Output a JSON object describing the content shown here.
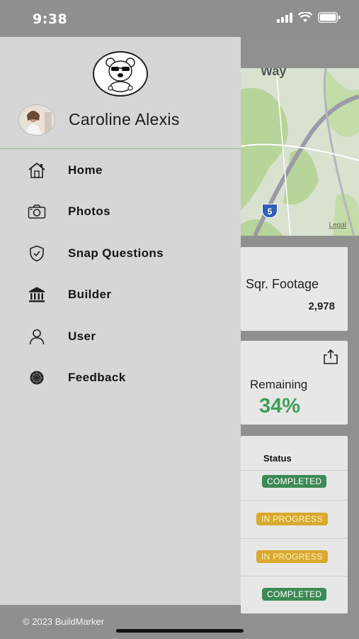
{
  "status_bar": {
    "time": "9:38"
  },
  "drawer": {
    "user_name": "Caroline Alexis",
    "menu": [
      {
        "label": "Home",
        "icon": "home-icon"
      },
      {
        "label": "Photos",
        "icon": "camera-icon"
      },
      {
        "label": "Snap Questions",
        "icon": "shield-icon"
      },
      {
        "label": "Builder",
        "icon": "bank-icon"
      },
      {
        "label": "User",
        "icon": "user-icon"
      },
      {
        "label": "Feedback",
        "icon": "feedback-icon"
      }
    ],
    "footer": "© 2023 BuildMarker"
  },
  "background": {
    "map": {
      "road_label": "Way",
      "route_shield": "5",
      "legal": "Legal"
    },
    "sqft": {
      "label": "Sqr. Footage",
      "value": "2,978"
    },
    "remaining": {
      "label": "Remaining",
      "value": "34%"
    },
    "table": {
      "header": "Status",
      "rows": [
        {
          "status": "COMPLETED"
        },
        {
          "status": "IN PROGRESS"
        },
        {
          "status": "IN PROGRESS"
        },
        {
          "status": "COMPLETED"
        }
      ]
    }
  },
  "colors": {
    "accent_green": "#3f9d58",
    "completed": "#3d8a55",
    "in_progress": "#d8a92d"
  }
}
